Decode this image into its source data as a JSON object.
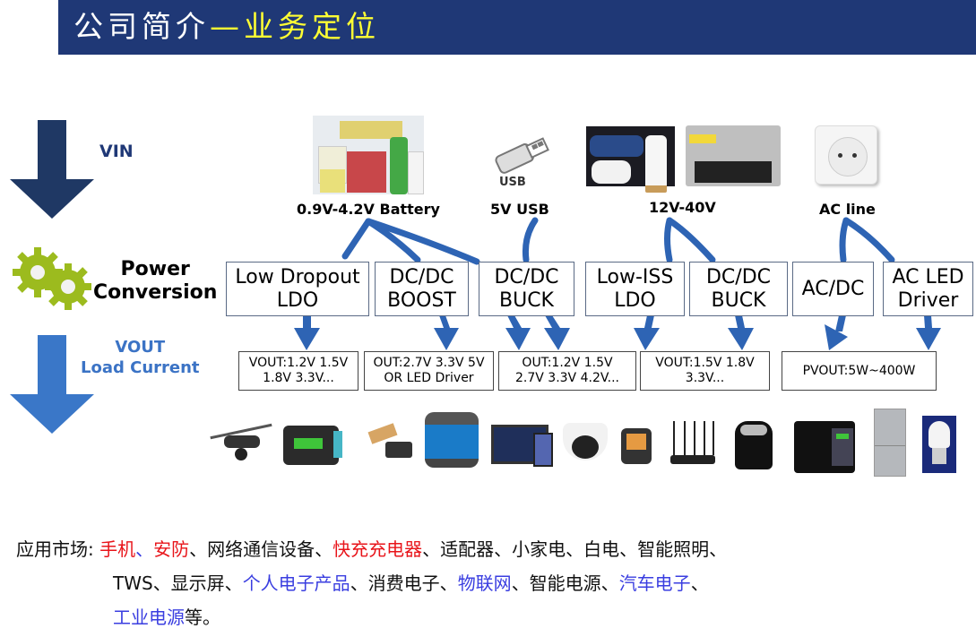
{
  "header": {
    "title_main": "公司简介",
    "title_highlight": "—业务定位",
    "bg_color": "#1f3876",
    "highlight_color": "#ffff33"
  },
  "flow_labels": {
    "vin": "VIN",
    "power_line1": "Power",
    "power_line2": "Conversion",
    "vout_line1": "VOUT",
    "vout_line2": "Load Current"
  },
  "sources": [
    {
      "label": "0.9V-4.2V Battery",
      "image": "battery-photo"
    },
    {
      "label": "5V USB",
      "image": "usb-icon",
      "image_caption": "USB"
    },
    {
      "label": "12V-40V",
      "image": "car-charger-and-power-supply-photo"
    },
    {
      "label": "AC line",
      "image": "wall-socket-photo"
    }
  ],
  "converters": [
    {
      "line1": "Low Dropout",
      "line2": "LDO"
    },
    {
      "line1": "DC/DC",
      "line2": "BOOST"
    },
    {
      "line1": "DC/DC",
      "line2": "BUCK"
    },
    {
      "line1": "Low-ISS",
      "line2": "LDO"
    },
    {
      "line1": "DC/DC",
      "line2": "BUCK"
    },
    {
      "line1": "AC/DC",
      "line2": ""
    },
    {
      "line1": "AC LED",
      "line2": "Driver"
    }
  ],
  "outputs": [
    {
      "line1": "VOUT:1.2V 1.5V",
      "line2": "1.8V 3.3V..."
    },
    {
      "line1": "OUT:2.7V 3.3V 5V",
      "line2": "OR LED Driver"
    },
    {
      "line1": "OUT:1.2V 1.5V",
      "line2": "2.7V 3.3V 4.2V..."
    },
    {
      "line1": "VOUT:1.5V 1.8V",
      "line2": "3.3V..."
    },
    {
      "line1": "PVOUT:5W~400W",
      "line2": ""
    }
  ],
  "products": [
    "drone",
    "card-reader",
    "power-bank",
    "bluetooth-speaker",
    "tablet-and-phone",
    "dome-camera",
    "smart-watch",
    "wifi-router",
    "air-fryer",
    "usb-charger",
    "refrigerator",
    "led-bulb"
  ],
  "market": {
    "label": "应用市场: ",
    "line1": [
      {
        "text": "手机",
        "color": "red"
      },
      {
        "text": "、",
        "color": "blue"
      },
      {
        "text": "安防",
        "color": "red"
      },
      {
        "text": "、网络通信设备、",
        "color": "black"
      },
      {
        "text": "快充充电器",
        "color": "red"
      },
      {
        "text": "、适配器、小家电、白电、智能照明、",
        "color": "black"
      }
    ],
    "line2": [
      {
        "text": "TWS、显示屏、",
        "color": "black"
      },
      {
        "text": "个人电子产品",
        "color": "blue"
      },
      {
        "text": "、消费电子、",
        "color": "black"
      },
      {
        "text": "物联网",
        "color": "blue"
      },
      {
        "text": "、智能电源、",
        "color": "black"
      },
      {
        "text": "汽车电子",
        "color": "blue"
      },
      {
        "text": "、",
        "color": "black"
      }
    ],
    "line3": [
      {
        "text": "工业电源",
        "color": "blue"
      },
      {
        "text": "等。",
        "color": "black"
      }
    ]
  },
  "colors": {
    "arrow_dark": "#1f3864",
    "arrow_light": "#3a77c8",
    "connector": "#2e64b4",
    "gear": "#9cbb1e"
  }
}
